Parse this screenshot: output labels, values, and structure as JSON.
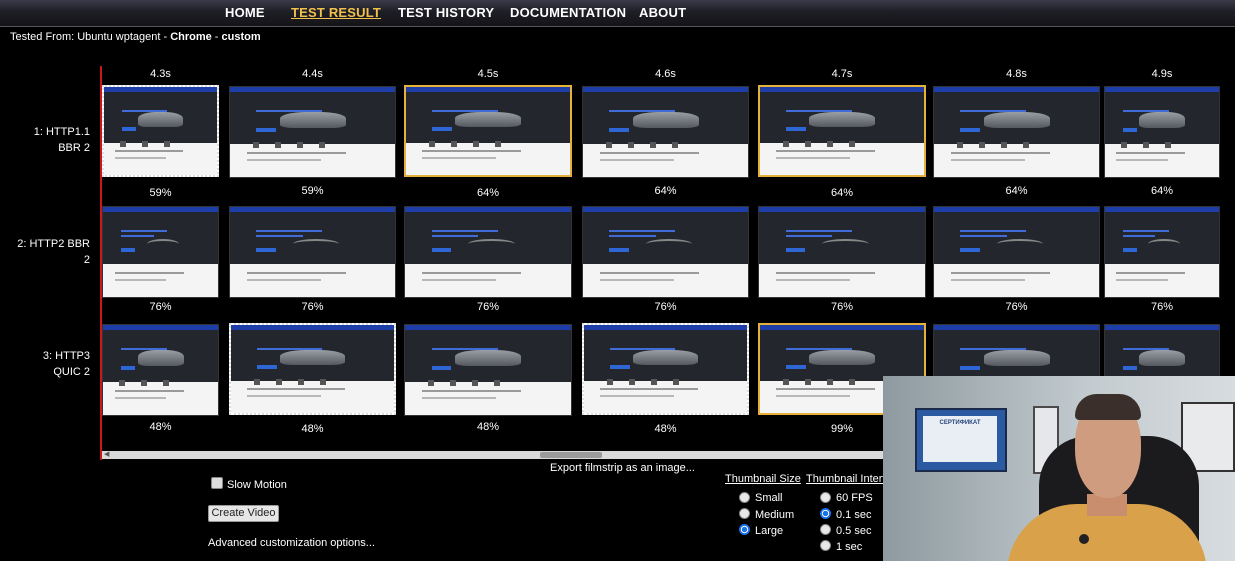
{
  "nav": {
    "home": "HOME",
    "test_result": "TEST RESULT",
    "test_history": "TEST HISTORY",
    "documentation": "DOCUMENTATION",
    "about": "ABOUT"
  },
  "tested_from": {
    "prefix": "Tested From: Ubuntu wptagent - ",
    "browser": "Chrome",
    "separator": " - ",
    "profile": "custom"
  },
  "timeline": [
    "4.3s",
    "4.4s",
    "4.5s",
    "4.6s",
    "4.7s",
    "4.8s",
    "4.9s"
  ],
  "rows": [
    {
      "label": "1: HTTP1.1 BBR 2",
      "frames": [
        {
          "pct": "59%",
          "state": "dotted"
        },
        {
          "pct": "59%",
          "state": "normal"
        },
        {
          "pct": "64%",
          "state": "changed"
        },
        {
          "pct": "64%",
          "state": "normal"
        },
        {
          "pct": "64%",
          "state": "changed"
        },
        {
          "pct": "64%",
          "state": "normal"
        },
        {
          "pct": "64%",
          "state": "normal"
        }
      ]
    },
    {
      "label": "2: HTTP2 BBR 2",
      "frames": [
        {
          "pct": "76%",
          "state": "normal"
        },
        {
          "pct": "76%",
          "state": "normal"
        },
        {
          "pct": "76%",
          "state": "normal"
        },
        {
          "pct": "76%",
          "state": "normal"
        },
        {
          "pct": "76%",
          "state": "normal"
        },
        {
          "pct": "76%",
          "state": "normal"
        },
        {
          "pct": "76%",
          "state": "normal"
        }
      ]
    },
    {
      "label": "3: HTTP3 QUIC 2",
      "frames": [
        {
          "pct": "48%",
          "state": "normal"
        },
        {
          "pct": "48%",
          "state": "dotted"
        },
        {
          "pct": "48%",
          "state": "normal"
        },
        {
          "pct": "48%",
          "state": "dotted"
        },
        {
          "pct": "99%",
          "state": "changed"
        },
        {
          "pct": "",
          "state": "normal"
        },
        {
          "pct": "",
          "state": "normal"
        }
      ]
    }
  ],
  "controls": {
    "export_link": "Export filmstrip as an image...",
    "slow_motion": "Slow Motion",
    "slow_motion_checked": false,
    "create_video": "Create Video",
    "advanced": "Advanced customization options..."
  },
  "thumbnail_size": {
    "title": "Thumbnail Size",
    "options": [
      "Small",
      "Medium",
      "Large"
    ],
    "selected": "Large"
  },
  "thumbnail_interval": {
    "title": "Thumbnail Interval",
    "options": [
      "60 FPS",
      "0.1 sec",
      "0.5 sec",
      "1 sec"
    ],
    "selected": "0.1 sec"
  },
  "webcam": {
    "certificate_text": "СЕРТИФИКАТ"
  },
  "colors": {
    "accent": "#f2c14e",
    "changed_border": "#e5b13b",
    "timeline_marker": "#c81818",
    "radio_selected": "#1a73e8"
  }
}
